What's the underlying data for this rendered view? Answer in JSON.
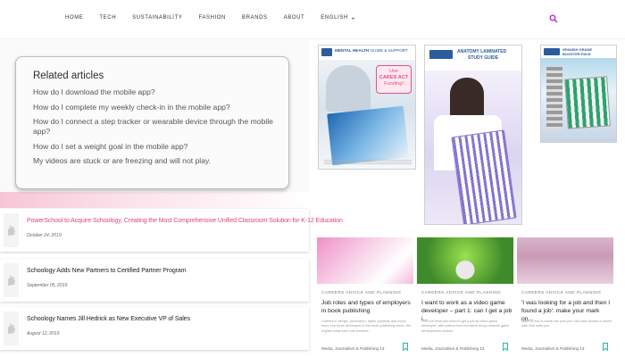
{
  "nav": {
    "items": [
      "HOME",
      "TECH",
      "SUSTAINABILITY",
      "FASHION",
      "BRANDS",
      "ABOUT",
      "ENGLISH"
    ]
  },
  "colors": {
    "accent": "#e0457b",
    "search": "#c02ad6",
    "bookmark": "#2bb5a0"
  },
  "related": {
    "title": "Related articles",
    "items": [
      "How do I download the mobile app?",
      "How do I complete my weekly check-in in the mobile app?",
      "How do I connect a step tracker or wearable device through the mobile app?",
      "How do I set a weight goal in the mobile app?",
      "My videos are stuck or are freezing and will not play."
    ]
  },
  "news": [
    {
      "title": "PowerSchool to Acquire Schoology, Creating the Most Comprehensive Unified Classroom Solution for K-12 Education",
      "date": "October 24, 2019"
    },
    {
      "title": "Schoology Adds New Partners to Certified Partner Program",
      "date": "September 05, 2019"
    },
    {
      "title": "Schoology Names Jill Hedrick as New Executive VP of Sales",
      "date": "August 12, 2019"
    }
  ],
  "ads": [
    {
      "title": "MENTAL HEALTH",
      "subtitle": "GUIDE & SUPPORT",
      "badge_line1": "Use",
      "badge_line2": "CARES ACT",
      "badge_line3": "Funding!"
    },
    {
      "title": "ANATOMY LAMINATED",
      "subtitle": "STUDY GUIDE"
    },
    {
      "title": "SPANISH GRADE",
      "subtitle": "BOOSTER PACK"
    }
  ],
  "cards": [
    {
      "category": "CAREERS ADVICE AND PLANNING",
      "title": "Job roles and types of employers in book publishing",
      "excerpt": "Careers in design, production, rights, publicity and much more can all be developed in the book publishing world. We explain what each role involves...",
      "meta": "Media, Journalism & Publishing  13"
    },
    {
      "category": "CAREERS ADVICE AND PLANNING",
      "title": "I want to work as a video game developer – part 1: can I get a job i...",
      "excerpt": "Find out what you need to get a job as video game developer, with advice from recruiters at top network game development studios.",
      "meta": "Media, Journalism & Publishing  13"
    },
    {
      "category": "CAREERS ADVICE AND PLANNING",
      "title": "'I was looking for a job and then I found a job': make your mark on...",
      "excerpt": "Make a real in-roads into your job roles and choose a career path that suits you.",
      "meta": "Media, Journalism & Publishing  13"
    }
  ]
}
